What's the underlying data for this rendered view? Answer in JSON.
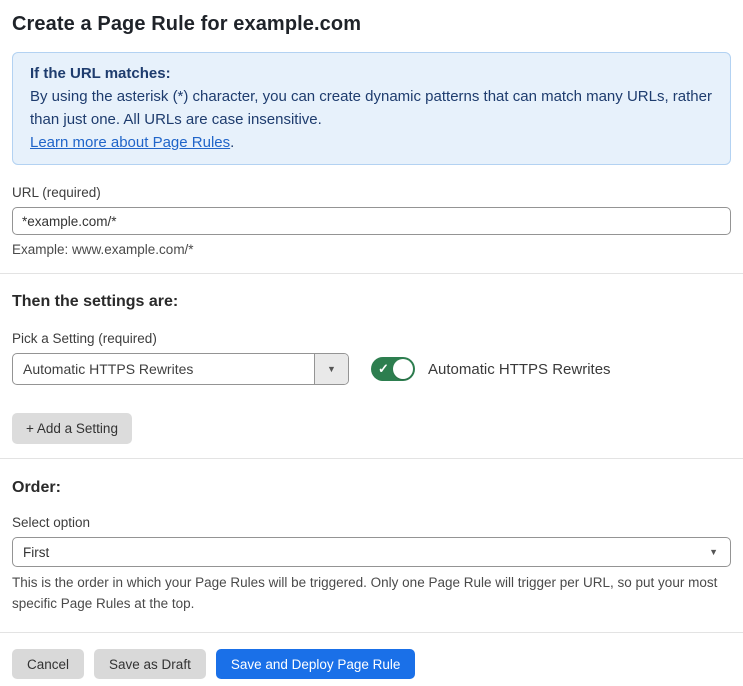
{
  "page": {
    "title": "Create a Page Rule for example.com"
  },
  "info_box": {
    "heading": "If the URL matches:",
    "body": "By using the asterisk (*) character, you can create dynamic patterns that can match many URLs, rather than just one. All URLs are case insensitive.",
    "link_label": "Learn more about Page Rules",
    "link_suffix": "."
  },
  "url_field": {
    "label": "URL (required)",
    "value": "*example.com/*",
    "helper": "Example: www.example.com/*"
  },
  "settings_section": {
    "heading": "Then the settings are:",
    "picker_label": "Pick a Setting (required)",
    "picker_value": "Automatic HTTPS Rewrites",
    "picker_arrow": "▼",
    "toggle_state": "on",
    "toggle_check": "✓",
    "toggle_label": "Automatic HTTPS Rewrites",
    "add_setting_label": "+ Add a Setting"
  },
  "order_section": {
    "heading": "Order:",
    "select_label": "Select option",
    "select_value": "First",
    "select_arrow": "▼",
    "helper": "This is the order in which your Page Rules will be triggered. Only one Page Rule will trigger per URL, so put your most specific Page Rules at the top."
  },
  "footer": {
    "cancel_label": "Cancel",
    "save_draft_label": "Save as Draft",
    "save_deploy_label": "Save and Deploy Page Rule"
  },
  "colors": {
    "accent_blue": "#1a70e8",
    "info_box_bg": "#e7f1fb",
    "info_box_border": "#b3d2f2",
    "info_text": "#1e3c6e",
    "link_blue": "#2065c9",
    "toggle_green": "#2d7e4f",
    "button_gray": "#d9d9d9"
  }
}
